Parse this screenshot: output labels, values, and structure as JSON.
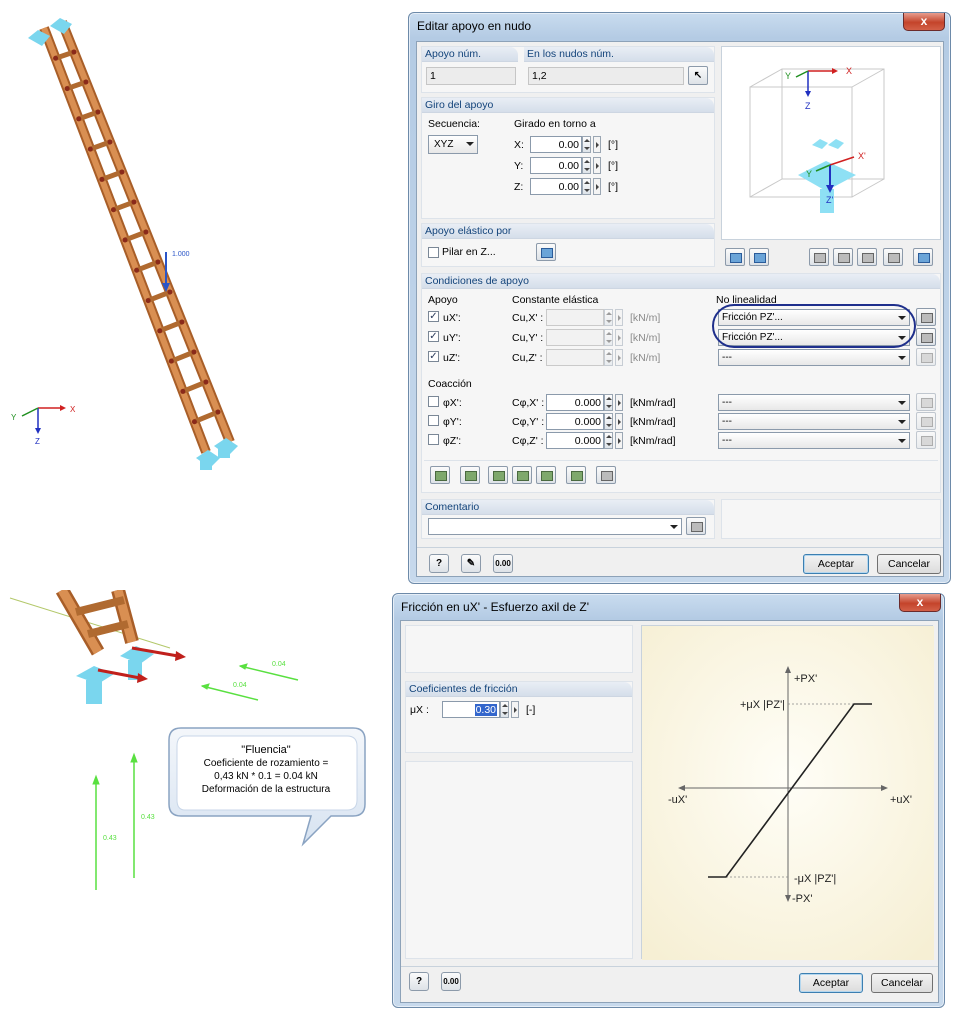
{
  "model_top": {
    "load_label": "1.000",
    "axes": {
      "x": "X",
      "y": "Y",
      "z": "Z"
    }
  },
  "model_bottom": {
    "load_values": [
      "0.04",
      "0.04",
      "0.43",
      "0.43"
    ]
  },
  "callout": {
    "lines": [
      "\"Fluencia\"",
      "Coeficiente de rozamiento =",
      "0,43 kN * 0.1 = 0.04 kN",
      "Deformación de la estructura"
    ]
  },
  "dialog1": {
    "title": "Editar apoyo en nudo",
    "close_label": "x",
    "support_no": {
      "label": "Apoyo núm.",
      "value": "1"
    },
    "nodes": {
      "label": "En los nudos núm.",
      "value": "1,2"
    },
    "rotation": {
      "header": "Giro del apoyo",
      "sequence_label": "Secuencia:",
      "sequence_value": "XYZ",
      "rotated_label": "Girado en torno a",
      "rows": [
        {
          "axis": "X:",
          "value": "0.00",
          "unit": "[°]"
        },
        {
          "axis": "Y:",
          "value": "0.00",
          "unit": "[°]"
        },
        {
          "axis": "Z:",
          "value": "0.00",
          "unit": "[°]"
        }
      ]
    },
    "elastic": {
      "header": "Apoyo elástico por",
      "column_label": "Pilar en Z..."
    },
    "conditions": {
      "header": "Condiciones de apoyo",
      "col_support": "Apoyo",
      "col_constant": "Constante elástica",
      "col_nonlinear": "No linealidad",
      "translations": [
        {
          "label": "uX':",
          "const": "Cu,X' :",
          "unit": "[kN/m]",
          "nonlinear": "Fricción PZ'..."
        },
        {
          "label": "uY':",
          "const": "Cu,Y' :",
          "unit": "[kN/m]",
          "nonlinear": "Fricción PZ'..."
        },
        {
          "label": "uZ':",
          "const": "Cu,Z' :",
          "unit": "[kN/m]",
          "nonlinear": "---"
        }
      ],
      "restraint_label": "Coacción",
      "rotations": [
        {
          "label": "φX':",
          "const": "Cφ,X' :",
          "value": "0.000",
          "unit": "[kNm/rad]",
          "nonlinear": "---"
        },
        {
          "label": "φY':",
          "const": "Cφ,Y' :",
          "value": "0.000",
          "unit": "[kNm/rad]",
          "nonlinear": "---"
        },
        {
          "label": "φZ':",
          "const": "Cφ,Z' :",
          "value": "0.000",
          "unit": "[kNm/rad]",
          "nonlinear": "---"
        }
      ]
    },
    "comment": {
      "header": "Comentario",
      "value": ""
    },
    "preview_axes": {
      "x": "X",
      "y": "Y",
      "z": "Z",
      "xp": "X'",
      "yp": "Y",
      "zp": "Z'"
    },
    "ok_label": "Aceptar",
    "cancel_label": "Cancelar"
  },
  "dialog2": {
    "title": "Fricción en uX' - Esfuerzo axil de Z'",
    "close_label": "x",
    "coef_header": "Coeficientes de fricción",
    "mu_label": "μX :",
    "mu_value": "0.30",
    "mu_unit": "[-]",
    "graph": {
      "py_pos": "+PX'",
      "py_neg": "-PX'",
      "ux_pos": "+uX'",
      "ux_neg": "-uX'",
      "mu_pos": "+μX |PZ'|",
      "mu_neg": "-μX |PZ'|"
    },
    "ok_label": "Aceptar",
    "cancel_label": "Cancelar"
  },
  "colors": {
    "ladder": "#c77a3c",
    "support": "#7ad6ee",
    "load_arrow": "#2a55c8",
    "green_load": "#59e040",
    "red_arrow": "#c0201c",
    "dialog_accent": "#12437a"
  }
}
